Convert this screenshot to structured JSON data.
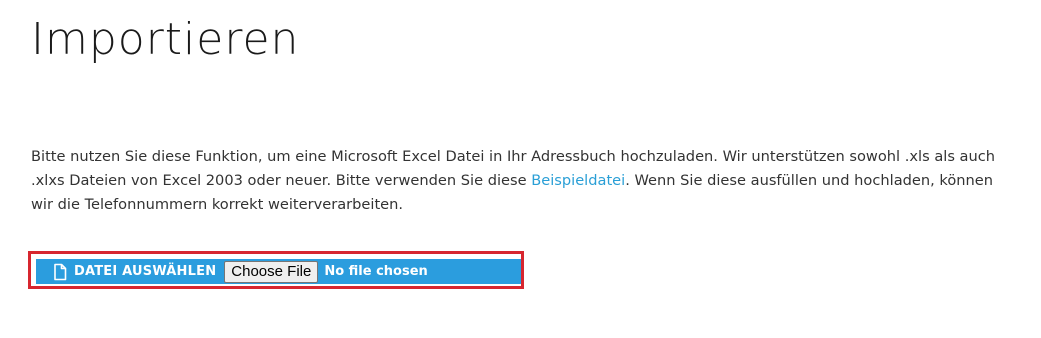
{
  "page": {
    "title": "Importieren"
  },
  "intro": {
    "text_before_link": "Bitte nutzen Sie diese Funktion, um eine Microsoft Excel Datei in Ihr Adressbuch hochzuladen. Wir unterstützen sowohl .xls als auch .xlxs Dateien von Excel 2003 oder neuer. Bitte verwenden Sie diese ",
    "link_text": "Beispieldatei",
    "text_after_link": ". Wenn Sie diese ausfüllen und hochladen, können wir die Telefonnummern korrekt weiterverarbeiten."
  },
  "upload": {
    "icon": "file-icon",
    "label": "DATEI AUSWÄHLEN",
    "choose_button": "Choose File",
    "status": "No file chosen"
  },
  "colors": {
    "accent_blue": "#2b9dde",
    "highlight_red": "#d7262f",
    "link_blue": "#2a9fd6"
  }
}
